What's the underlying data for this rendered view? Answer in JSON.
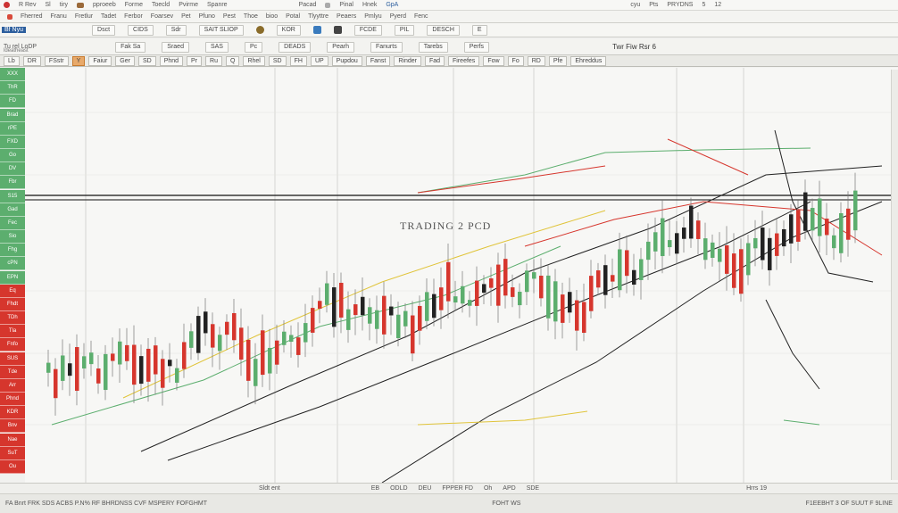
{
  "title_bar": {
    "items": [
      "R Rev",
      "Sl",
      "tiry",
      "pproeeb",
      "Forme",
      "Toecld",
      "Pvirme",
      "Spanre",
      "Pacad",
      "Pinal",
      "Hnek"
    ],
    "right_items": [
      "GpA",
      "cyu",
      "Pts",
      "PRYDNS",
      "5",
      "12"
    ]
  },
  "menu_bar": {
    "items": [
      "Fherred",
      "Franu",
      "Fretlur",
      "Tadet",
      "Ferbor",
      "Foarsev",
      "Pet",
      "Pfuno",
      "Pest",
      "Thoe",
      "bioo",
      "Potal",
      "Tlyyttre",
      "Peaers",
      "Pmlyu",
      "Pyerd",
      "Fenc"
    ]
  },
  "toolbar1": {
    "left": "Bf Nyu",
    "buttons": [
      "Dsct",
      "CIDS",
      "Sdr",
      "SAIT SLIOP",
      "KOR",
      "FCDE",
      "PIL",
      "DESCH",
      "E"
    ]
  },
  "toolbar2": {
    "left": "Tu rel LoDP",
    "sub": "ldeatheast",
    "buttons": [
      "Fak Sa",
      "Sraed",
      "SAS",
      "Pc",
      "DEADS",
      "Pearh",
      "Fanurts",
      "Tarebs",
      "Perfs"
    ],
    "right": "Twr Fiw Rsr 6"
  },
  "toolbar3": {
    "buttons": [
      "Lb",
      "DR",
      "FSstr",
      "Y",
      "Faiur",
      "Ger",
      "SD",
      "Phnd",
      "Pr",
      "Ru",
      "Q",
      "Rhel",
      "SD",
      "FH",
      "UP",
      "Pupdou",
      "Fanst",
      "Rinder",
      "Fad",
      "Fireefes",
      "Fow",
      "Fo",
      "RD",
      "Pfe",
      "Ehreddus"
    ]
  },
  "chart": {
    "title": "TRADING 2 PCD",
    "colors": {
      "up": "#5cae6e",
      "down": "#d6362d",
      "dark": "#222222",
      "yellow": "#e0c43a"
    }
  },
  "left_panel": {
    "green_labels": [
      "XXX",
      "ThR",
      "FD",
      "Brad",
      "rPE",
      "FXD",
      "Go",
      "DV",
      "Fbr",
      "S15",
      "Gad",
      "Fec",
      "Sio",
      "Fhg",
      "cPN",
      "EPN"
    ],
    "red_labels": [
      "Eq",
      "Fhdt",
      "TDh",
      "Tla",
      "Fnfo",
      "SUS",
      "Tde",
      "Arr",
      "Phnd",
      "KDR",
      "Bnv",
      "Nae",
      "SuT",
      "Ou"
    ]
  },
  "status_bar": {
    "items": [
      "Sldt ent",
      "EB",
      "ODLD",
      "DEU",
      "FPPER FD",
      "Oh",
      "APD",
      "SDE"
    ],
    "right": "Hrrs 19"
  },
  "footer": {
    "left": "FA Bnrt FRK SDS ACBS P.N% RF BHRDNSS CVF MSPERY FOFGHMT",
    "middle": "FOHT WS",
    "right": "F1EEBHT 3 OF SUUT F 9LINE"
  }
}
